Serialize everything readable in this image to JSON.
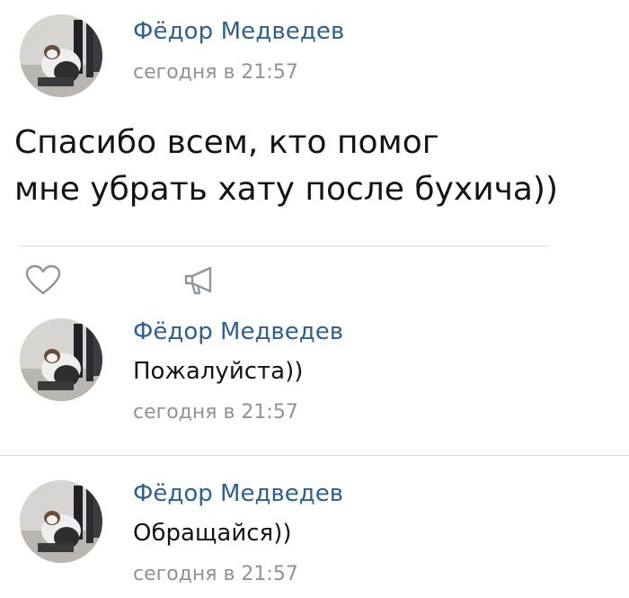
{
  "post": {
    "author": "Фёдор Медведев",
    "time": "сегодня в 21:57",
    "text_lines": [
      "Спасибо всем, кто помог",
      "мне убрать хату после  бухича))"
    ]
  },
  "actions": {
    "like_icon": "heart-icon",
    "share_icon": "megaphone-icon"
  },
  "comments": [
    {
      "author": "Фёдор Медведев",
      "text": "Пожалуйста))",
      "time": "сегодня в 21:57"
    },
    {
      "author": "Фёдор Медведев",
      "text": "Обращайся))",
      "time": "сегодня в 21:57"
    }
  ],
  "colors": {
    "author": "#2f5f8e",
    "time": "#8f9398",
    "text": "#141414",
    "divider": "#d8dadd"
  }
}
